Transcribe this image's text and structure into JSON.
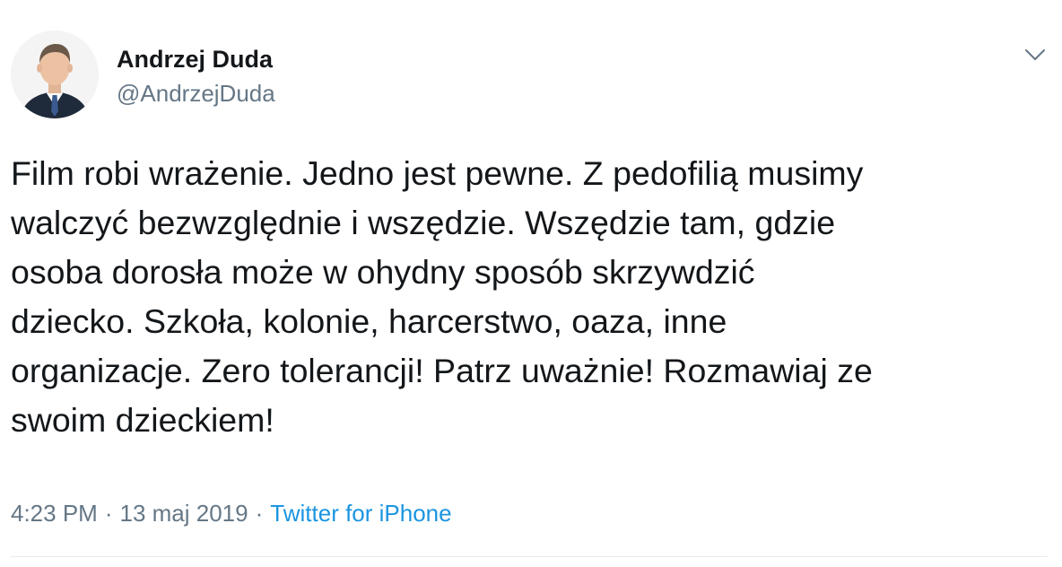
{
  "author": {
    "name": "Andrzej Duda",
    "handle": "@AndrzejDuda"
  },
  "tweet": {
    "lines": [
      "Film robi wrażenie. Jedno jest pewne. Z pedofilią musimy",
      "walczyć bezwzględnie i wszędzie. Wszędzie tam, gdzie",
      "osoba dorosła może w ohydny sposób skrzywdzić",
      "dziecko. Szkoła, kolonie, harcerstwo, oaza, inne",
      "organizacje. Zero tolerancji! Patrz uważnie! Rozmawiaj ze",
      "swoim dzieckiem!"
    ],
    "time": "4:23 PM",
    "separator": "·",
    "date": "13 maj 2019",
    "source": "Twitter for iPhone"
  },
  "icons": {
    "more": "chevron-down-icon",
    "avatar": "avatar-photo"
  },
  "colors": {
    "text": "#14171a",
    "secondary": "#657786",
    "link": "#1b95e0",
    "divider": "#e6ecf0"
  }
}
